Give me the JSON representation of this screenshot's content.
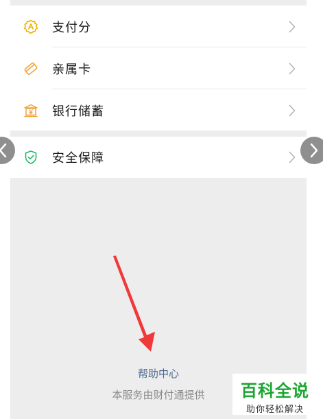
{
  "menu_group_1": {
    "items": [
      {
        "label": "支付分",
        "icon": "score-badge-icon"
      },
      {
        "label": "亲属卡",
        "icon": "family-card-icon"
      },
      {
        "label": "银行储蓄",
        "icon": "bank-deposit-icon"
      }
    ]
  },
  "menu_group_2": {
    "items": [
      {
        "label": "安全保障",
        "icon": "shield-check-icon"
      }
    ]
  },
  "footer": {
    "help_link": "帮助中心",
    "provider_text": "本服务由财付通提供"
  },
  "watermark": {
    "main": "百科全说",
    "sub": "助你轻松解决"
  },
  "colors": {
    "icon_yellow": "#f2b100",
    "icon_orange": "#f0a33a",
    "icon_green": "#1fb86a",
    "link_blue": "#4f6990",
    "annotation_red": "#f0393a",
    "watermark_green": "#1aa531"
  }
}
